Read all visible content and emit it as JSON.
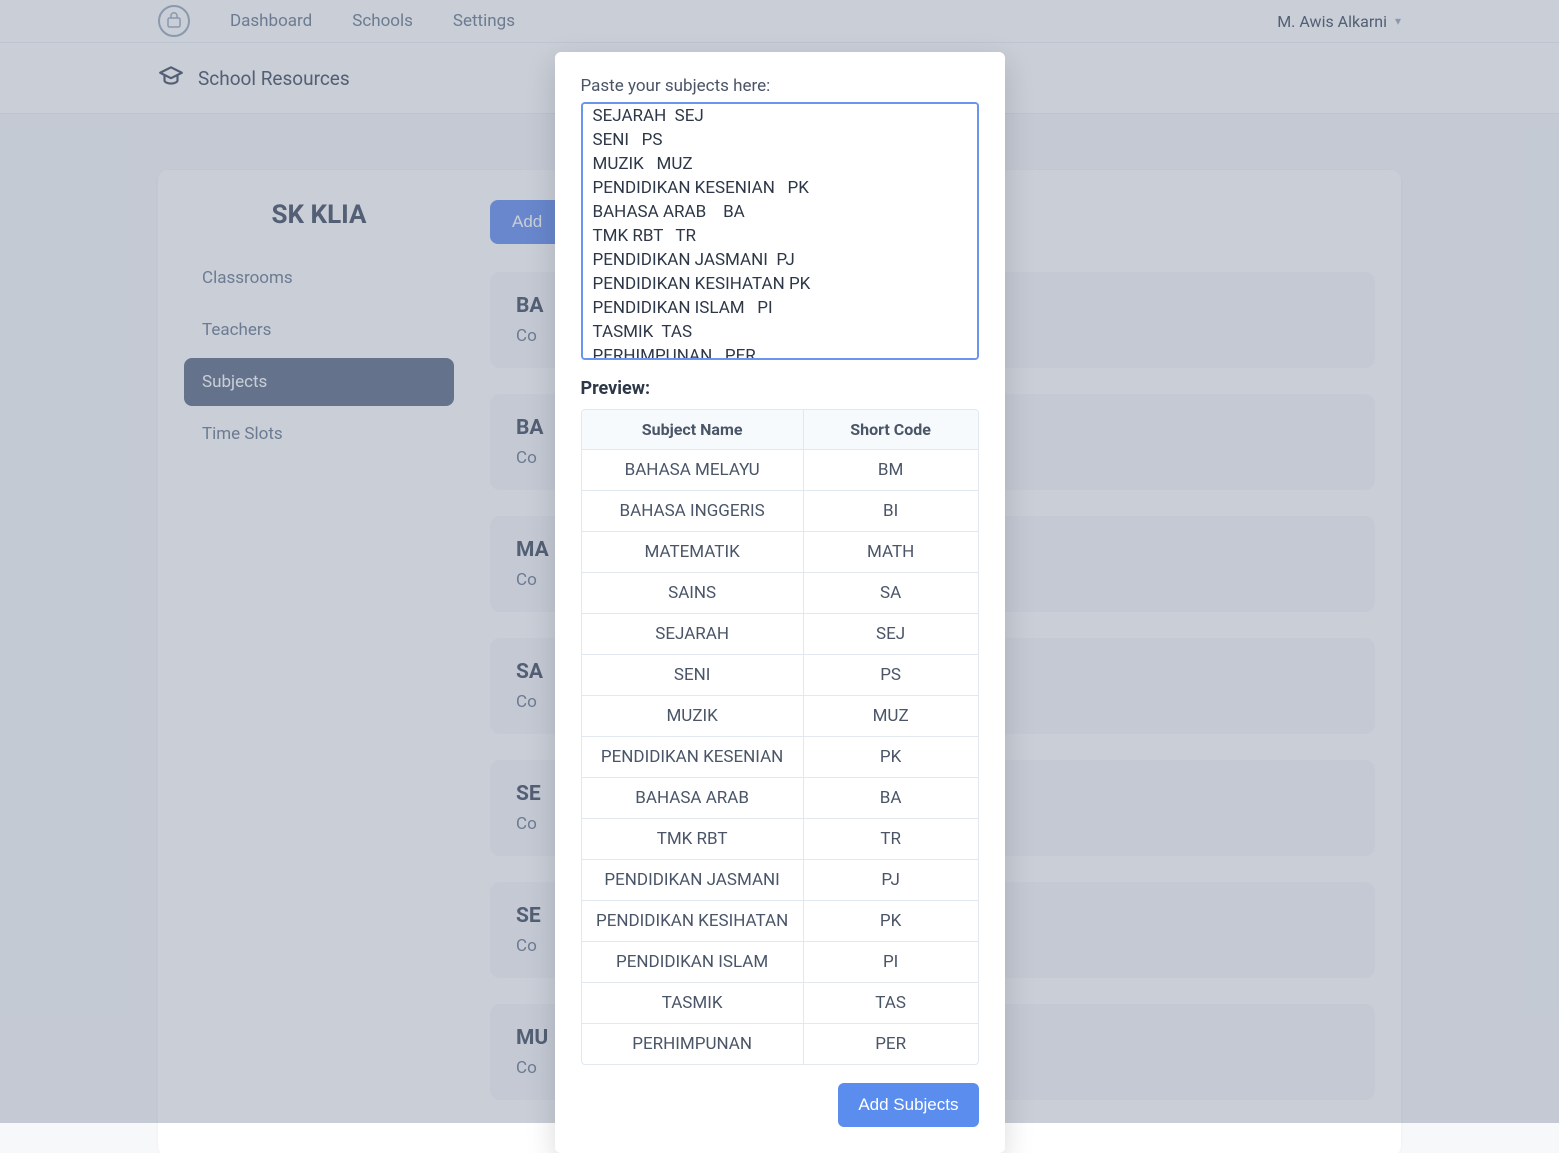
{
  "nav": {
    "items": [
      "Dashboard",
      "Schools",
      "Settings"
    ],
    "user_name": "M. Awis Alkarni"
  },
  "subheader": {
    "title": "School Resources"
  },
  "sidebar": {
    "school_name": "SK KLIA",
    "items": [
      {
        "label": "Classrooms",
        "active": false
      },
      {
        "label": "Teachers",
        "active": false
      },
      {
        "label": "Subjects",
        "active": true
      },
      {
        "label": "Time Slots",
        "active": false
      }
    ]
  },
  "main": {
    "add_button_label": "Add",
    "subject_cards": [
      {
        "title": "BA",
        "sub": "Co"
      },
      {
        "title": "BA",
        "sub": "Co"
      },
      {
        "title": "MA",
        "sub": "Co"
      },
      {
        "title": "SA",
        "sub": "Co"
      },
      {
        "title": "SE",
        "sub": "Co"
      },
      {
        "title": "SE",
        "sub": "Co"
      },
      {
        "title": "MU",
        "sub": "Co"
      }
    ]
  },
  "modal": {
    "paste_label": "Paste your subjects here:",
    "paste_value": "SEJARAH  SEJ\nSENI   PS\nMUZIK   MUZ\nPENDIDIKAN KESENIAN   PK\nBAHASA ARAB    BA\nTMK RBT   TR\nPENDIDIKAN JASMANI  PJ\nPENDIDIKAN KESIHATAN PK\nPENDIDIKAN ISLAM   PI\nTASMIK  TAS\nPERHIMPUNAN   PER",
    "preview_label": "Preview:",
    "table": {
      "headers": [
        "Subject Name",
        "Short Code"
      ],
      "rows": [
        [
          "BAHASA MELAYU",
          "BM"
        ],
        [
          "BAHASA INGGERIS",
          "BI"
        ],
        [
          "MATEMATIK",
          "MATH"
        ],
        [
          "SAINS",
          "SA"
        ],
        [
          "SEJARAH",
          "SEJ"
        ],
        [
          "SENI",
          "PS"
        ],
        [
          "MUZIK",
          "MUZ"
        ],
        [
          "PENDIDIKAN KESENIAN",
          "PK"
        ],
        [
          "BAHASA ARAB",
          "BA"
        ],
        [
          "TMK RBT",
          "TR"
        ],
        [
          "PENDIDIKAN JASMANI",
          "PJ"
        ],
        [
          "PENDIDIKAN KESIHATAN",
          "PK"
        ],
        [
          "PENDIDIKAN ISLAM",
          "PI"
        ],
        [
          "TASMIK",
          "TAS"
        ],
        [
          "PERHIMPUNAN",
          "PER"
        ]
      ]
    },
    "submit_label": "Add Subjects"
  }
}
